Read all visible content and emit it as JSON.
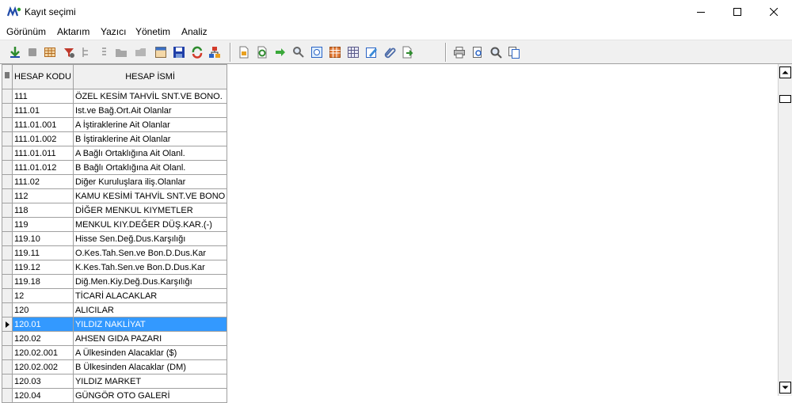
{
  "window": {
    "title": "Kayıt seçimi",
    "icon": "app-logo-icon",
    "buttons": [
      "minimize-icon",
      "maximize-icon",
      "close-icon"
    ]
  },
  "menu": [
    {
      "label": "Görünüm"
    },
    {
      "label": "Aktarım"
    },
    {
      "label": "Yazıcı"
    },
    {
      "label": "Yönetim"
    },
    {
      "label": "Analiz"
    }
  ],
  "toolbar": {
    "group1": [
      "add-record-icon",
      "disabled-icon",
      "table-view-icon",
      "filter-icon",
      "tree-icon",
      "indent-icon",
      "folder-icon",
      "folder-disabled-icon",
      "grid-icon",
      "save-icon",
      "refresh-icon",
      "hierarchy-icon"
    ],
    "group2": [
      "document-icon",
      "sync-icon",
      "go-arrow-icon",
      "find-icon",
      "print-preview-icon",
      "calendar-icon",
      "table-grid-icon",
      "edit-icon",
      "attach-icon",
      "export-icon"
    ],
    "group3": [
      "print-icon",
      "preview-icon",
      "zoom-icon",
      "copy-icon"
    ]
  },
  "grid": {
    "headers": {
      "code": "HESAP KODU",
      "name": "HESAP İSMİ"
    },
    "selected_index": 16,
    "rows": [
      {
        "code": "111",
        "name": "ÖZEL KESİM TAHVİL SNT.VE BONO."
      },
      {
        "code": "111.01",
        "name": "Ist.ve Bağ.Ort.Ait Olanlar"
      },
      {
        "code": "111.01.001",
        "name": "A İştiraklerine Ait Olanlar"
      },
      {
        "code": "111.01.002",
        "name": "B İştiraklerine Ait Olanlar"
      },
      {
        "code": "111.01.011",
        "name": "A Bağlı Ortaklığına Ait Olanl."
      },
      {
        "code": "111.01.012",
        "name": "B Bağlı Ortaklığına Ait Olanl."
      },
      {
        "code": "111.02",
        "name": "Diğer Kuruluşlara iliş.Olanlar"
      },
      {
        "code": "112",
        "name": "KAMU KESİMİ TAHVİL SNT.VE BONO"
      },
      {
        "code": "118",
        "name": "DİĞER MENKUL KIYMETLER"
      },
      {
        "code": "119",
        "name": "MENKUL KIY.DEĞER DÜŞ.KAR.(-)"
      },
      {
        "code": "119.10",
        "name": "Hisse Sen.Değ.Dus.Karşılığı"
      },
      {
        "code": "119.11",
        "name": "O.Kes.Tah.Sen.ve Bon.D.Dus.Kar"
      },
      {
        "code": "119.12",
        "name": "K.Kes.Tah.Sen.ve Bon.D.Dus.Kar"
      },
      {
        "code": "119.18",
        "name": "Diğ.Men.Kiy.Değ.Dus.Karşılığı"
      },
      {
        "code": "12",
        "name": "TİCARİ ALACAKLAR"
      },
      {
        "code": "120",
        "name": "ALICILAR"
      },
      {
        "code": "120.01",
        "name": "YILDIZ NAKLİYAT"
      },
      {
        "code": "120.02",
        "name": "AHSEN GIDA PAZARI"
      },
      {
        "code": "120.02.001",
        "name": "A Ülkesinden Alacaklar ($)"
      },
      {
        "code": "120.02.002",
        "name": "B Ülkesinden Alacaklar (DM)"
      },
      {
        "code": "120.03",
        "name": "YILDIZ MARKET"
      },
      {
        "code": "120.04",
        "name": "GÜNGÖR OTO GALERİ"
      }
    ]
  }
}
